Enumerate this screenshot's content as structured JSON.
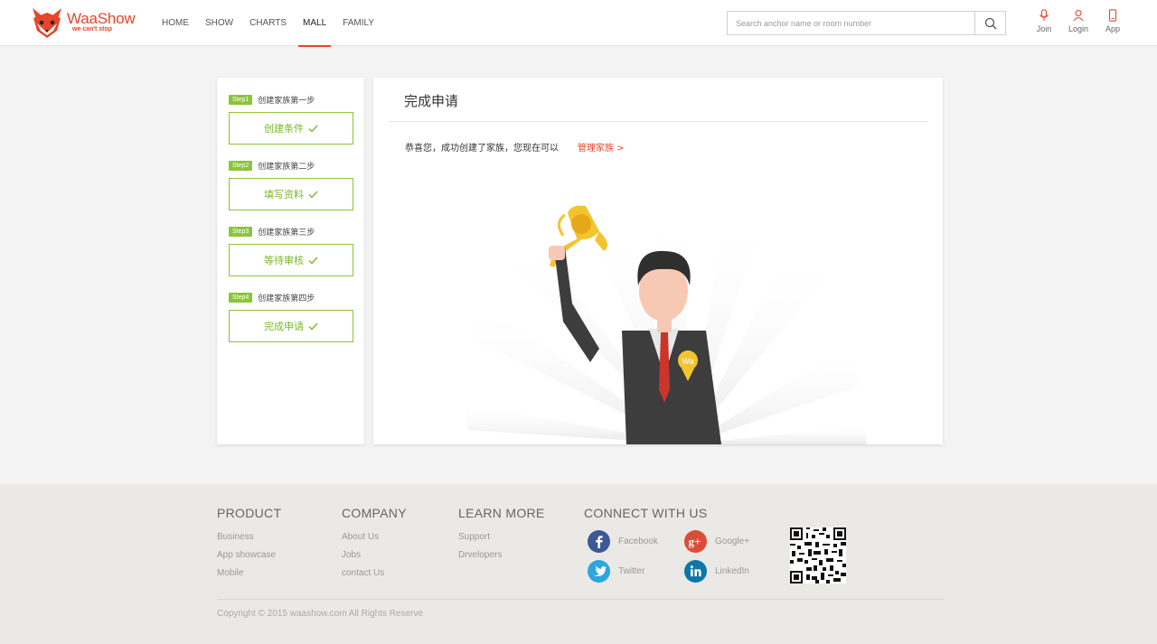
{
  "brand": {
    "name": "WaaShow",
    "tagline": "we can't stop",
    "color": "#e8452b"
  },
  "nav": {
    "items": [
      {
        "label": "HOME"
      },
      {
        "label": "SHOW"
      },
      {
        "label": "CHARTS"
      },
      {
        "label": "MALL",
        "active": true
      },
      {
        "label": "FAMILY"
      }
    ]
  },
  "search": {
    "placeholder": "Search anchor name or room number",
    "value": ""
  },
  "top_actions": {
    "join": "Join",
    "login": "Login",
    "app": "App"
  },
  "steps": [
    {
      "badge": "Step1",
      "title": "创建家族第一步",
      "label": "创建条件"
    },
    {
      "badge": "Step2",
      "title": "创建家族第二步",
      "label": "填写资料"
    },
    {
      "badge": "Step3",
      "title": "创建家族第三步",
      "label": "等待审核"
    },
    {
      "badge": "Step4",
      "title": "创建家族第四步",
      "label": "完成申请"
    }
  ],
  "main": {
    "title": "完成申请",
    "message": "恭喜您，成功创建了家族，您现在可以",
    "link": "管理家族 >",
    "medal_text": "Wa"
  },
  "colors": {
    "accent": "#e8452b",
    "step_green": "#8cc43a"
  },
  "footer": {
    "product": {
      "heading": "PRODUCT",
      "links": [
        "Business",
        "App showcase",
        "Mobile"
      ]
    },
    "company": {
      "heading": "COMPANY",
      "links": [
        "About Us",
        "Jobs",
        "contact Us"
      ]
    },
    "learn": {
      "heading": "LEARN MORE",
      "links": [
        "Support",
        "Drvelopers"
      ]
    },
    "connect": {
      "heading": "CONNECT WITH US",
      "facebook": "Facebook",
      "googleplus": "Google+",
      "twitter": "Twitter",
      "linkedin": "LinkedIn"
    },
    "copyright": "Copyright © 2015 waashow.com All Rights Reserve"
  }
}
